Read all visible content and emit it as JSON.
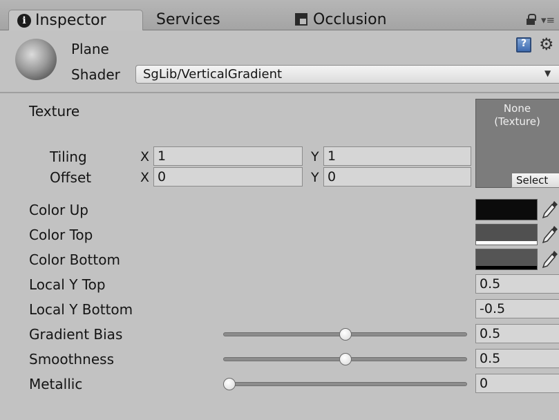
{
  "tabs": {
    "inspector": "Inspector",
    "services": "Services",
    "occlusion": "Occlusion"
  },
  "material": {
    "name": "Plane",
    "shader_label": "Shader",
    "shader_value": "SgLib/VerticalGradient"
  },
  "texture": {
    "label": "Texture",
    "slot_line1": "None",
    "slot_line2": "(Texture)",
    "select_label": "Select",
    "tiling_label": "Tiling",
    "offset_label": "Offset",
    "x_label": "X",
    "y_label": "Y",
    "tiling_x": "1",
    "tiling_y": "1",
    "offset_x": "0",
    "offset_y": "0"
  },
  "colors": {
    "up_label": "Color Up",
    "top_label": "Color Top",
    "bottom_label": "Color Bottom",
    "up_value": "#0b0b0b",
    "top_value": "#505050",
    "bottom_value": "#555555"
  },
  "floats": {
    "local_y_top_label": "Local Y Top",
    "local_y_top_value": "0.5",
    "local_y_bottom_label": "Local Y Bottom",
    "local_y_bottom_value": "-0.5"
  },
  "sliders": {
    "gradient_bias_label": "Gradient Bias",
    "gradient_bias_value": "0.5",
    "smoothness_label": "Smoothness",
    "smoothness_value": "0.5",
    "metallic_label": "Metallic",
    "metallic_value": "0"
  },
  "icons": {
    "tab": "info-icon",
    "occlusion": "occlusion-icon",
    "lock": "lock-icon",
    "menu": "menu-icon",
    "help": "help-book-icon",
    "settings": "gear-icon",
    "picker": "eyedropper-icon"
  }
}
